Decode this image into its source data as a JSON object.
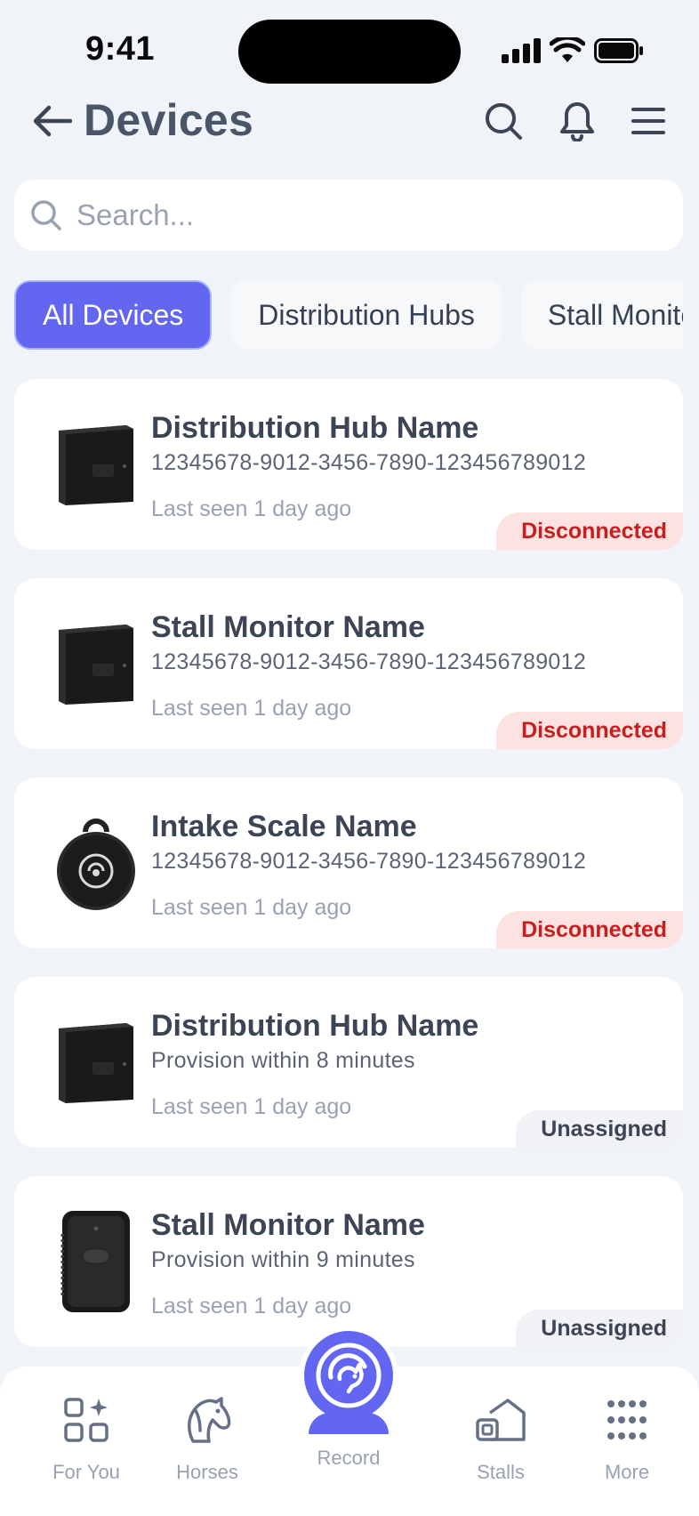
{
  "status_bar": {
    "time": "9:41"
  },
  "header": {
    "title": "Devices"
  },
  "search": {
    "placeholder": "Search..."
  },
  "filters": [
    {
      "label": "All Devices",
      "active": true
    },
    {
      "label": "Distribution Hubs",
      "active": false
    },
    {
      "label": "Stall Monitors",
      "active": false
    }
  ],
  "devices": [
    {
      "name": "Distribution Hub Name",
      "detail": "12345678-9012-3456-7890-123456789012",
      "last_seen": "Last seen 1 day ago",
      "status": "Disconnected",
      "icon": "hub-device-icon"
    },
    {
      "name": "Stall Monitor Name",
      "detail": "12345678-9012-3456-7890-123456789012",
      "last_seen": "Last seen 1 day ago",
      "status": "Disconnected",
      "icon": "hub-device-icon"
    },
    {
      "name": "Intake Scale Name",
      "detail": "12345678-9012-3456-7890-123456789012",
      "last_seen": "Last seen 1 day ago",
      "status": "Disconnected",
      "icon": "intake-scale-icon"
    },
    {
      "name": "Distribution Hub Name",
      "detail": "Provision within 8 minutes",
      "last_seen": "Last seen 1 day ago",
      "status": "Unassigned",
      "icon": "hub-device-icon"
    },
    {
      "name": "Stall Monitor Name",
      "detail": "Provision within 9 minutes",
      "last_seen": "Last seen 1 day ago",
      "status": "Unassigned",
      "icon": "stall-monitor-icon"
    }
  ],
  "nav": {
    "for_you": "For You",
    "horses": "Horses",
    "record": "Record",
    "stalls": "Stalls",
    "more": "More"
  },
  "colors": {
    "accent": "#6366F1",
    "background": "#F0F3F8",
    "disconnected_bg": "#FDE2E2",
    "disconnected_text": "#C81E1E",
    "unassigned_bg": "#F0F2F6"
  }
}
